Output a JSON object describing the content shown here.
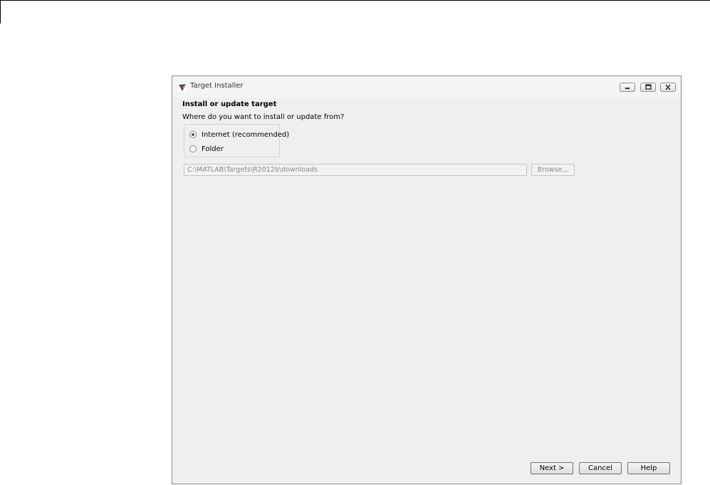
{
  "window": {
    "title": "Target Installer",
    "controls": {
      "minimize_icon": "minimize-icon",
      "maximize_icon": "maximize-icon",
      "close_icon": "close-icon"
    }
  },
  "wizard": {
    "heading": "Install or update target",
    "question": "Where do you want to install or update from?",
    "source_options": [
      {
        "label": "Internet (recommended)",
        "selected": true
      },
      {
        "label": "Folder",
        "selected": false
      }
    ],
    "folder_path": "C:\\MATLAB\\Targets\\R2012b\\downloads",
    "browse_label": "Browse...",
    "buttons": {
      "next": "Next >",
      "cancel": "Cancel",
      "help": "Help"
    }
  },
  "colors": {
    "window_bg": "#efefef",
    "radio_fill": "#3d5e8a",
    "disabled_text": "#8a8a8a"
  }
}
